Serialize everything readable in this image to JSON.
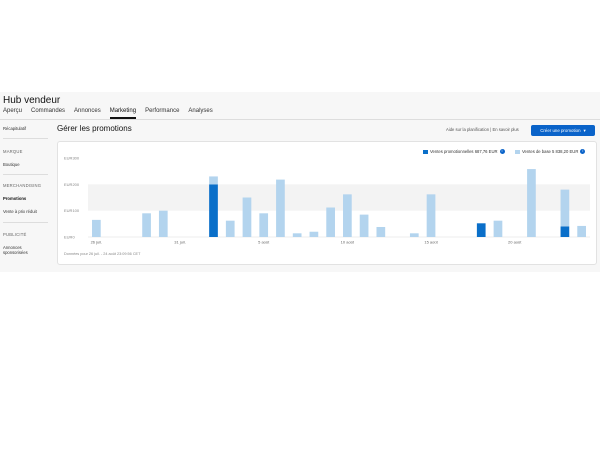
{
  "app": {
    "title": "Hub vendeur"
  },
  "topnav": [
    {
      "label": "Aperçu",
      "active": false
    },
    {
      "label": "Commandes",
      "active": false
    },
    {
      "label": "Annonces",
      "active": false
    },
    {
      "label": "Marketing",
      "active": true
    },
    {
      "label": "Performance",
      "active": false
    },
    {
      "label": "Analyses",
      "active": false
    }
  ],
  "sidebar": {
    "summary": "Récapitulatif",
    "brand_header": "MARQUE",
    "store": "Boutique",
    "merch_header": "MERCHANDISING",
    "promotions": "Promotions",
    "markdown": "Vente à prix réduit",
    "ads_header": "PUBLICITÉ",
    "sponsored_line1": "Annonces",
    "sponsored_line2": "sponsorisées"
  },
  "main": {
    "title": "Gérer les promotions",
    "help_text": "Aide sur la planification | En savoir plus",
    "create_button": "Créer une promotion",
    "footer": "Données pour 26 juil. - 24 août 23:09:56 CET"
  },
  "legend": {
    "promo": "Ventes promotionnelles 687,76 EUR",
    "base": "Ventes de base 5 838,20 EUR"
  },
  "colors": {
    "promo": "#0a6fc9",
    "base": "#b3d4ee",
    "accent": "#0a63c9"
  },
  "chart_data": {
    "type": "bar",
    "stacked": true,
    "y_tick_labels": [
      "EUR0",
      "EUR100",
      "EUR200",
      "EUR300"
    ],
    "ylim": [
      0,
      300
    ],
    "x_tick_labels": [
      "26 juil.",
      "31 juil.",
      "5 août",
      "10 août",
      "15 août",
      "20 août"
    ],
    "x_tick_positions": [
      0,
      5,
      10,
      15,
      20,
      25
    ],
    "days": 30,
    "series": [
      {
        "name": "Ventes promotionnelles",
        "values": [
          0,
          0,
          0,
          0,
          0,
          0,
          0,
          200,
          0,
          0,
          0,
          0,
          0,
          0,
          0,
          0,
          0,
          0,
          0,
          0,
          0,
          0,
          0,
          52,
          0,
          0,
          0,
          0,
          40,
          0
        ]
      },
      {
        "name": "Ventes de base",
        "values": [
          65,
          0,
          0,
          90,
          100,
          0,
          0,
          30,
          62,
          150,
          90,
          218,
          14,
          20,
          112,
          162,
          85,
          38,
          0,
          14,
          162,
          0,
          0,
          0,
          62,
          0,
          258,
          0,
          140,
          42
        ]
      }
    ]
  }
}
